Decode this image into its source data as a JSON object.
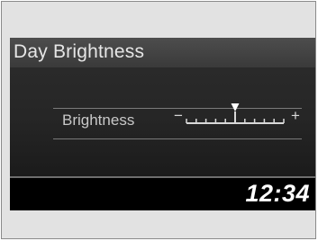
{
  "screen": {
    "title": "Day Brightness"
  },
  "setting": {
    "label": "Brightness",
    "minus_symbol": "−",
    "plus_symbol": "+",
    "level": 6,
    "level_max": 11,
    "indicator_icon": "triangle-down-icon"
  },
  "status": {
    "clock": "12:34"
  },
  "colors": {
    "background": "#000000",
    "title_bar": "#444444",
    "text": "#ffffff"
  }
}
